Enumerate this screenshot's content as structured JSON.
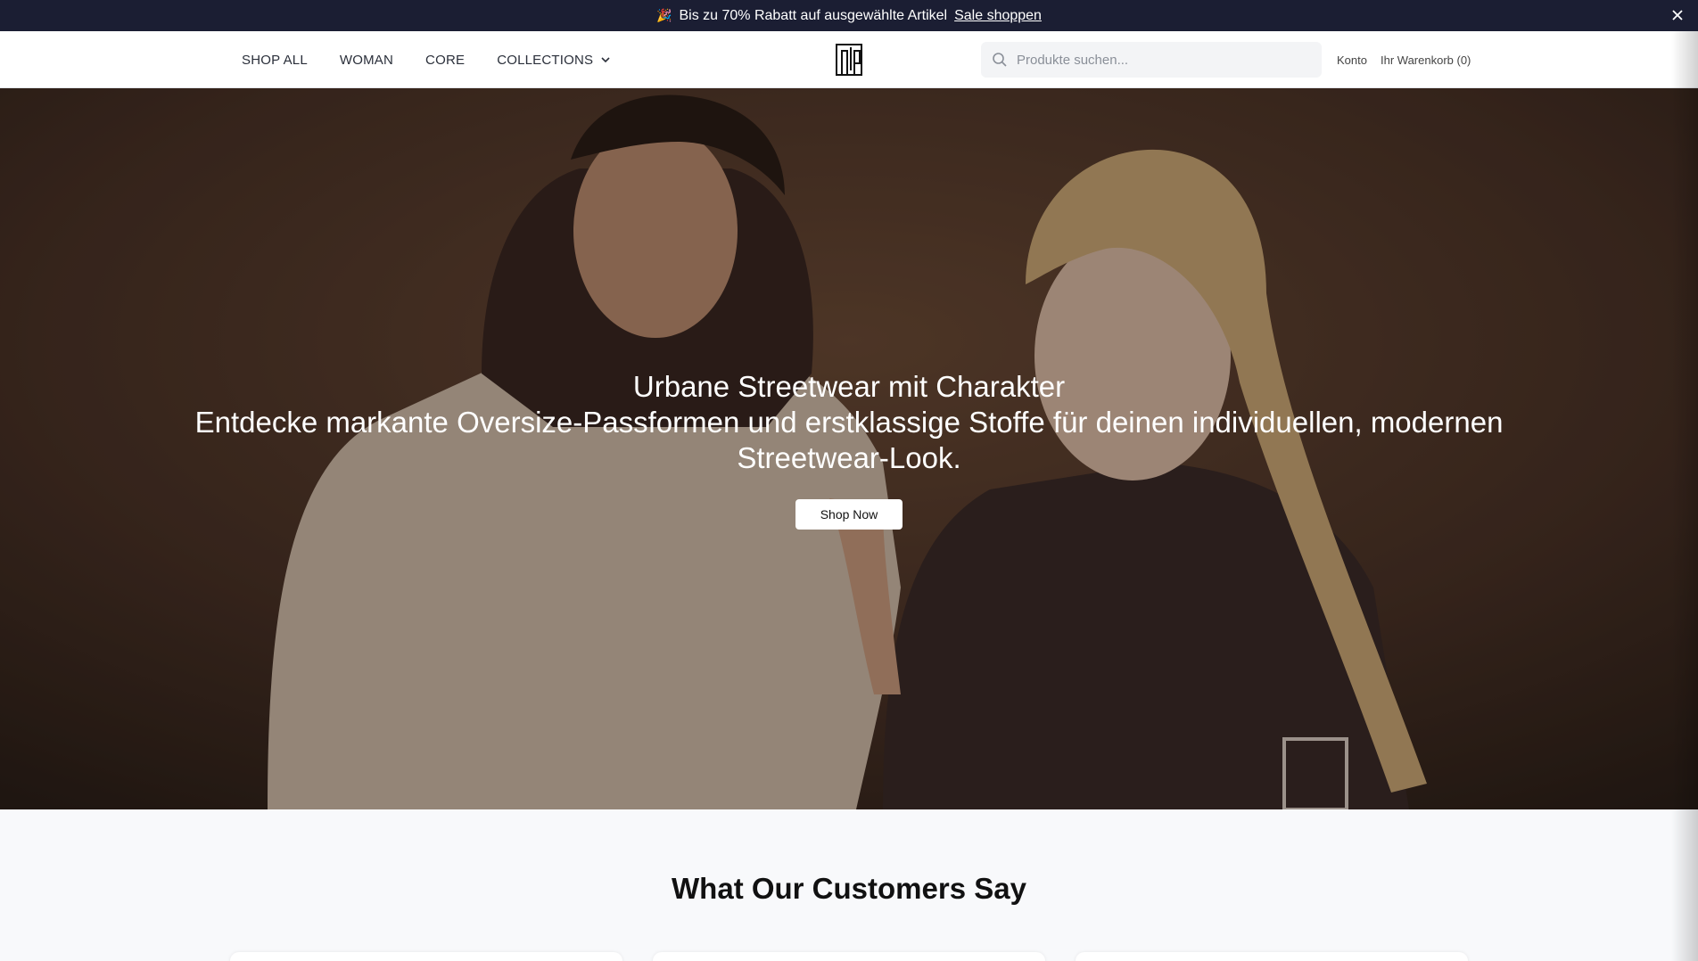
{
  "announcement": {
    "emoji": "🎉",
    "text": "Bis zu 70% Rabatt auf ausgewählte Artikel",
    "link_label": "Sale shoppen"
  },
  "nav": {
    "items": [
      {
        "label": "SHOP ALL"
      },
      {
        "label": "WOMAN"
      },
      {
        "label": "CORE"
      },
      {
        "label": "COLLECTIONS"
      }
    ]
  },
  "search": {
    "placeholder": "Produkte suchen..."
  },
  "header": {
    "account_label": "Konto",
    "cart_label": "Ihr Warenkorb (0)"
  },
  "hero": {
    "title": "Urbane Streetwear mit Charakter",
    "subtitle": "Entdecke markante Oversize-Passformen und erstklassige Stoffe für deinen individuellen, modernen Streetwear-Look.",
    "cta_label": "Shop Now"
  },
  "testimonials": {
    "heading": "What Our Customers Say"
  },
  "colors": {
    "announcement_bg": "#1b1e33",
    "header_bg": "#ffffff",
    "hero_bg": "#4d3527",
    "section_bg": "#f8f9fb"
  },
  "icons": [
    "close-icon",
    "chevron-down-icon",
    "brand-logo",
    "search-icon"
  ]
}
